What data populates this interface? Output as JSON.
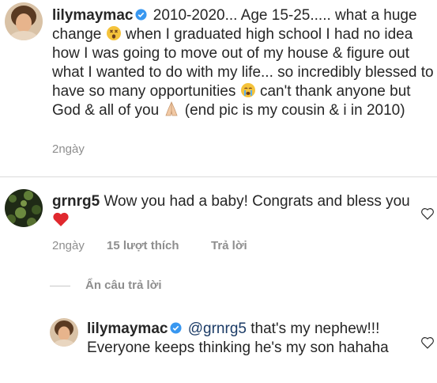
{
  "post": {
    "username": "lilymaymac",
    "caption_1": "2010-2020... Age 15-25..... what a huge change",
    "caption_2": "when I graduated high school I had no idea how I was going to move out of my house & figure out what I wanted to do with my life... so incredibly blessed to have so many opportunities",
    "caption_3": "can't thank anyone but God & all of you",
    "caption_4": "(end pic is my cousin & i in 2010)",
    "time": "2ngày"
  },
  "comment": {
    "username": "grnrg5",
    "text": "Wow you had a baby! Congrats and bless you",
    "time": "2ngày",
    "likes": "15 lượt thích",
    "reply_label": "Trả lời",
    "hide_replies": "Ẩn câu trả lời"
  },
  "reply": {
    "username": "lilymaymac",
    "mention": "@grnrg5",
    "text": "that's my nephew!!! Everyone keeps thinking he's my son hahaha"
  },
  "colors": {
    "verified": "#3897f0",
    "heart_red": "#ed4956",
    "meta_gray": "#8e8e8e"
  }
}
